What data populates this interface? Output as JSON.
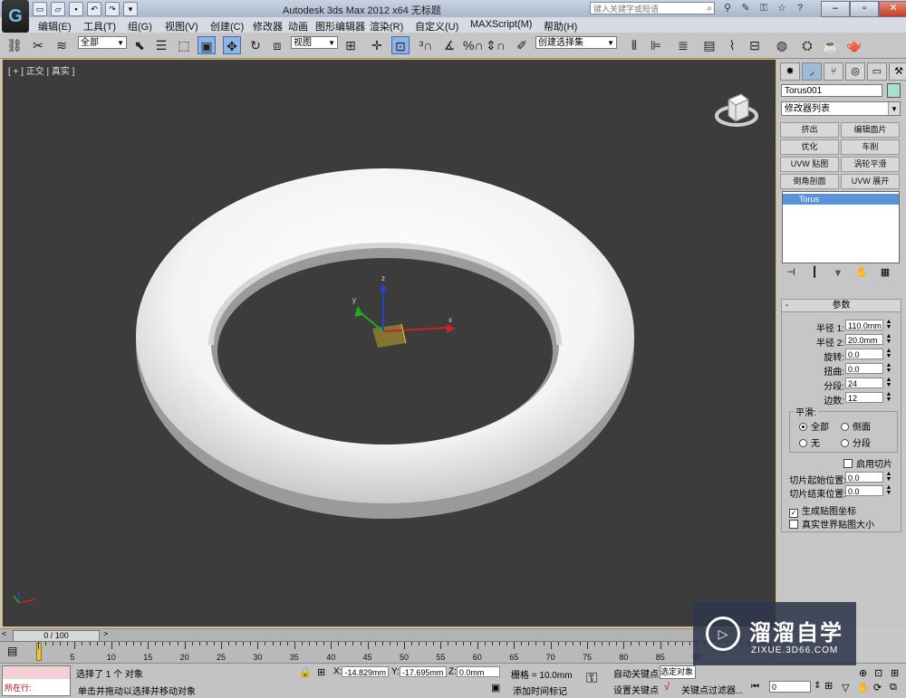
{
  "title_bar": {
    "logo": "G",
    "app_title": "Autodesk 3ds Max  2012 x64      无标题",
    "search_placeholder": "键入关键字或短语",
    "search_icon": "search-icon",
    "help": "?"
  },
  "menu": [
    "编辑(E)",
    "工具(T)",
    "组(G)",
    "视图(V)",
    "创建(C)",
    "修改器",
    "动画",
    "图形编辑器",
    "渲染(R)",
    "自定义(U)",
    "MAXScript(M)",
    "帮助(H)"
  ],
  "toolbar": {
    "selection_filter": "全部",
    "ref_coord": "视图",
    "named_selection": "创建选择集"
  },
  "viewport": {
    "label": "[ + ] 正交 | 真实 ]",
    "object_color": "#ffffff",
    "background": "#3c3c3c",
    "active_border": "#d6b84a"
  },
  "command_panel": {
    "object_name": "Torus001",
    "object_color": "#a8e0cc",
    "modifier_list": "修改器列表",
    "modifier_buttons": [
      "挤出",
      "编辑面片",
      "优化",
      "车削",
      "UVW 贴图",
      "涡轮平滑",
      "倒角剖面",
      "UVW 展开"
    ],
    "stack_item": "Torus",
    "rollout_title": "参数",
    "params": [
      {
        "label": "半径 1:",
        "value": "110.0mm"
      },
      {
        "label": "半径 2:",
        "value": "20.0mm"
      },
      {
        "label": "旋转:",
        "value": "0.0"
      },
      {
        "label": "扭曲:",
        "value": "0.0"
      },
      {
        "label": "分段:",
        "value": "24"
      },
      {
        "label": "边数:",
        "value": "12"
      }
    ],
    "smooth": {
      "title": "平滑:",
      "options": [
        "全部",
        "侧面",
        "无",
        "分段"
      ],
      "selected": "全部"
    },
    "slice_on": "启用切片",
    "slice_from_label": "切片起始位置:",
    "slice_from": "0.0",
    "slice_to_label": "切片结束位置:",
    "slice_to": "0.0",
    "gen_mapping": "生成贴图坐标",
    "real_world": "真实世界贴图大小"
  },
  "timeline": {
    "frame_display": "0 / 100",
    "current_frame": 0,
    "ruler_labels": [
      "5",
      "10",
      "15",
      "20",
      "25",
      "30",
      "35",
      "40",
      "45",
      "50",
      "55",
      "60",
      "65",
      "70",
      "75",
      "80",
      "85",
      "90"
    ]
  },
  "status": {
    "maxscript_label": "所在行:",
    "prompt_top": "选择了 1 个 对象",
    "prompt_bottom": "单击并拖动以选择并移动对象",
    "x_label": "X:",
    "x": "-14.829mm",
    "y_label": "Y:",
    "y": "-17.695mm",
    "z_label": "Z:",
    "z": "0.0mm",
    "grid": "栅格 = 10.0mm",
    "add_time_tag": "添加时间标记",
    "auto_key": "自动关键点",
    "selected": "选定对象",
    "set_key": "设置关键点",
    "key_filters": "关键点过滤器...",
    "frame_field": "0"
  },
  "watermark": {
    "title": "溜溜自学",
    "url": "ZIXUE.3D66.COM"
  }
}
